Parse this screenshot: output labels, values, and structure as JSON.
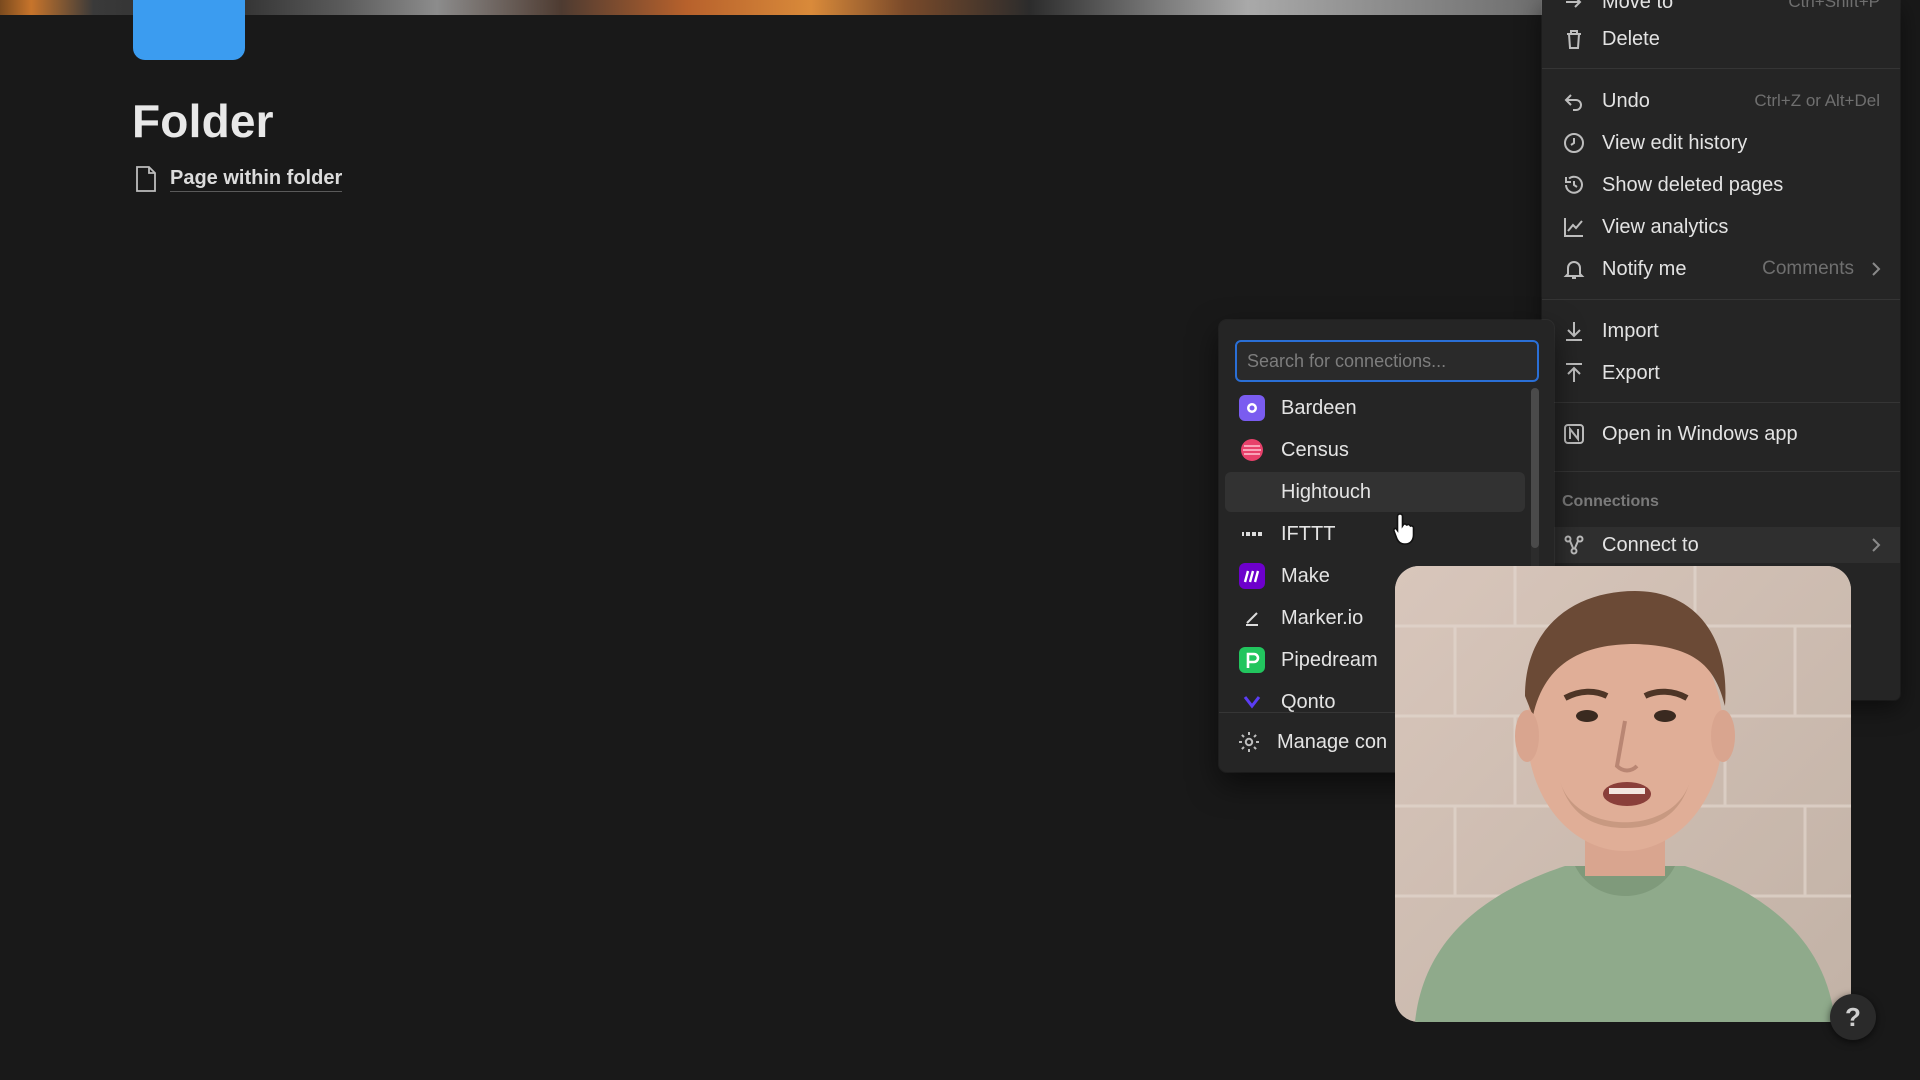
{
  "page": {
    "title": "Folder",
    "subpage_label": "Page within folder"
  },
  "menu": {
    "move_to": {
      "label": "Move to",
      "shortcut": "Ctrl+Shift+P"
    },
    "delete": {
      "label": "Delete"
    },
    "undo": {
      "label": "Undo",
      "shortcut": "Ctrl+Z or Alt+Del"
    },
    "view_edit_history": {
      "label": "View edit history"
    },
    "show_deleted_pages": {
      "label": "Show deleted pages"
    },
    "view_analytics": {
      "label": "View analytics"
    },
    "notify_me": {
      "label": "Notify me",
      "value": "Comments"
    },
    "import": {
      "label": "Import"
    },
    "export": {
      "label": "Export"
    },
    "open_in_app": {
      "label": "Open in Windows app"
    },
    "connections_section": "Connections",
    "connect_to": {
      "label": "Connect to"
    }
  },
  "connections": {
    "search_placeholder": "Search for connections...",
    "items": [
      {
        "label": "Bardeen",
        "color": "#7a5cf0"
      },
      {
        "label": "Census",
        "color": "#e8416b"
      },
      {
        "label": "Hightouch",
        "color": ""
      },
      {
        "label": "IFTTT",
        "color": "#1a1a1a"
      },
      {
        "label": "Make",
        "color": "#6d00cc"
      },
      {
        "label": "Marker.io",
        "color": "#2a2a2a"
      },
      {
        "label": "Pipedream",
        "color": "#22c55e"
      },
      {
        "label": "Qonto",
        "color": "#5b3df5"
      }
    ],
    "manage_label": "Manage con"
  },
  "help": {
    "label": "?"
  },
  "colors": {
    "background": "#191919",
    "menu_bg": "#252525",
    "accent_blue": "#2a6fd6",
    "folder_blue": "#3b9cf0"
  }
}
